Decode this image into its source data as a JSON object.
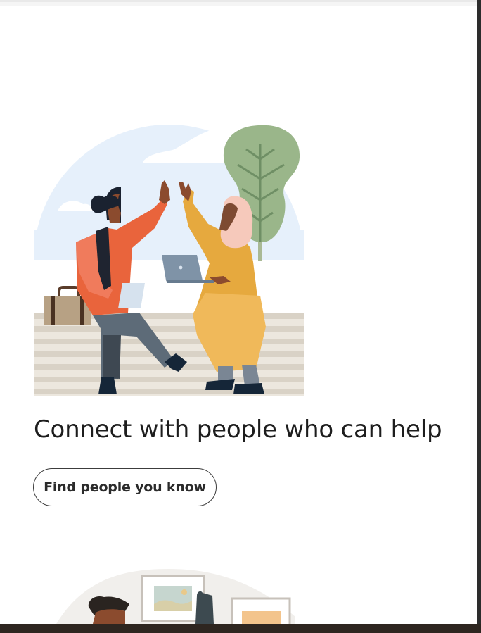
{
  "card": {
    "headline": "Connect with people who can help",
    "cta_label": "Find people you know"
  },
  "illustrations": {
    "hero": "two-people-high-five-illustration",
    "next": "person-at-desk-illustration"
  },
  "colors": {
    "headline_text": "#1d1d1d",
    "button_border": "#3c3c3c",
    "sky": "#e6f0fb",
    "tree": "#9ab68a",
    "bench_stripe": "#d9d2c6",
    "orange_jacket": "#e9643c",
    "mustard_dress": "#e6a93e",
    "bottom_bar": "#2e2620"
  }
}
